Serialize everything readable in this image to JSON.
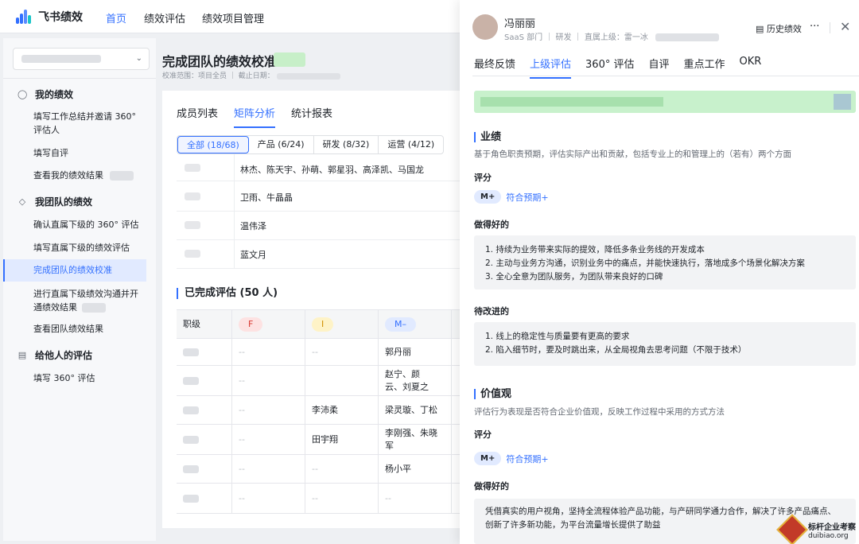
{
  "app": {
    "name": "飞书绩效"
  },
  "nav": [
    "首页",
    "绩效评估",
    "绩效项目管理"
  ],
  "sidebar": {
    "groups": [
      {
        "label": "我的绩效",
        "icon": "person-icon",
        "items": [
          "填写工作总结并邀请 360° 评估人",
          "填写自评",
          "查看我的绩效结果"
        ]
      },
      {
        "label": "我团队的绩效",
        "icon": "layers-icon",
        "items": [
          "确认直属下级的 360° 评估",
          "填写直属下级的绩效评估",
          "完成团队的绩效校准",
          "进行直属下级绩效沟通并开通绩效结果",
          "查看团队绩效结果"
        ]
      },
      {
        "label": "给他人的评估",
        "icon": "doc-icon",
        "items": [
          "填写 360° 评估"
        ]
      }
    ],
    "active": "完成团队的绩效校准"
  },
  "main": {
    "title": "完成团队的绩效校准",
    "meta": "校准范围：项目全员 ｜ 截止日期：",
    "tabs": [
      "成员列表",
      "矩阵分析",
      "统计报表"
    ],
    "active_tab": "矩阵分析",
    "filters": [
      "全部 (18/68)",
      "产品 (6/24)",
      "研发 (8/32)",
      "运营 (4/12)"
    ],
    "matrix_rows": [
      "林杰、陈天宇、孙萌、郭星羽、高泽凯、马国龙",
      "卫雨、牛晶晶",
      "温伟泽",
      "蓝文月"
    ],
    "completed_title": "已完成评估 (50 人)",
    "grid_header": {
      "label": "职级",
      "ratings": [
        "F",
        "I",
        "M–"
      ]
    },
    "grid_rows": [
      [
        "--",
        "--",
        "郭丹丽"
      ],
      [
        "--",
        "",
        "赵宁、颜云、刘夏之"
      ],
      [
        "--",
        "李沛柔",
        "梁灵璇、丁松"
      ],
      [
        "--",
        "田宇翔",
        "李刚强、朱晓军"
      ],
      [
        "--",
        "--",
        "杨小平"
      ],
      [
        "--",
        "--",
        "--"
      ]
    ]
  },
  "drawer": {
    "name": "冯丽丽",
    "sub": "SaaS 部门 ｜ 研发 ｜ 直属上级：雷一冰",
    "history": "历史绩效",
    "more": "···",
    "close": "✕",
    "tabs": [
      "最终反馈",
      "上级评估",
      "360° 评估",
      "自评",
      "重点工作",
      "OKR"
    ],
    "active_tab": "上级评估",
    "s1": {
      "title": "业绩",
      "desc": "基于角色职责预期，评估实际产出和贡献，包括专业上的和管理上的（若有）两个方面",
      "score_label": "评分",
      "badge": "M+",
      "rating": "符合预期+",
      "good_label": "做得好的",
      "good": [
        "1. 持续为业务带来实际的提效，降低多条业务线的开发成本",
        "2. 主动与业务方沟通，识别业务中的痛点，并能快速执行，落地成多个场景化解决方案",
        "3. 全心全意为团队服务，为团队带来良好的口碑"
      ],
      "improve_label": "待改进的",
      "improve": [
        "1. 线上的稳定性与质量要有更高的要求",
        "2. 陷入细节时，要及时跳出来，从全局视角去思考问题（不限于技术）"
      ]
    },
    "s2": {
      "title": "价值观",
      "desc": "评估行为表现是否符合企业价值观，反映工作过程中采用的方式方法",
      "score_label": "评分",
      "badge": "M+",
      "rating": "符合预期+",
      "good_label": "做得好的",
      "good": [
        "凭借真实的用户视角，坚持全流程体验产品功能，与产研同学通力合作，解决了许多产品痛点、",
        "创新了许多新功能，为平台流量增长提供了助益"
      ]
    }
  },
  "watermark": {
    "line1": "标杆企业考察",
    "line2": "duibiao.org"
  },
  "colors": {
    "accent": "#3370ff",
    "rating_f": "#fde2e2",
    "rating_i": "#fef3c7",
    "rating_m": "#e1eaff"
  }
}
